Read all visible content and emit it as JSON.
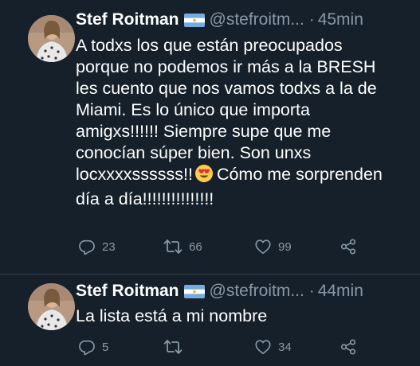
{
  "tweets": [
    {
      "display_name": "Stef Roitman",
      "handle": "@stefroitm...",
      "separator": "·",
      "time": "45min",
      "text_lines": [
        "A todxs los que están preocupados",
        "porque no podemos ir más a la BRESH",
        "les cuento que nos vamos todxs a la de",
        "Miami. Es lo único que importa",
        "amigxs!!!!!! Siempre supe que me",
        "conocían súper bien. Son unxs"
      ],
      "text_line_7_before": "locxxxxssssss!!",
      "text_line_7_after": "Cómo me sorprenden",
      "text_line_8": "día a día!!!!!!!!!!!!!!!",
      "reply_count": "23",
      "retweet_count": "66",
      "like_count": "99"
    },
    {
      "display_name": "Stef Roitman",
      "handle": "@stefroitm...",
      "separator": "·",
      "time": "44min",
      "text": "La lista está a mi nombre",
      "reply_count": "5",
      "retweet_count": "",
      "like_count": "34"
    }
  ],
  "icons": {
    "verified_flag": "argentina-flag-icon",
    "emoji": "heart-eyes-emoji-icon",
    "reply": "reply-icon",
    "retweet": "retweet-icon",
    "like": "like-icon",
    "share": "share-icon"
  },
  "colors": {
    "background": "#15202b",
    "secondary_text": "#8899a6",
    "primary_text": "#ffffff",
    "divider": "#38444d"
  }
}
